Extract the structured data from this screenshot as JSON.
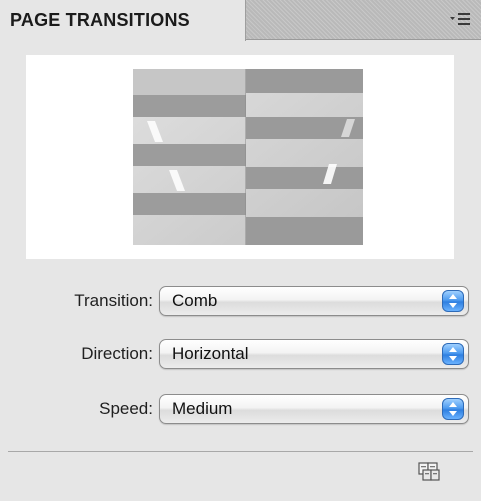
{
  "panel": {
    "tab_title": "PAGE TRANSITIONS",
    "menu_icon": "panel-menu-icon"
  },
  "preview": {
    "effect": "comb-horizontal",
    "icon": "transition-preview-image"
  },
  "fields": {
    "transition": {
      "label": "Transition:",
      "value": "Comb"
    },
    "direction": {
      "label": "Direction:",
      "value": "Horizontal"
    },
    "speed": {
      "label": "Speed:",
      "value": "Medium"
    }
  },
  "footer": {
    "apply_all_icon": "apply-to-all-spreads-icon"
  },
  "colors": {
    "panel_bg": "#e6e6e6",
    "tab_bg": "#b9b9b9",
    "select_arrow": "#3b8ae8"
  }
}
